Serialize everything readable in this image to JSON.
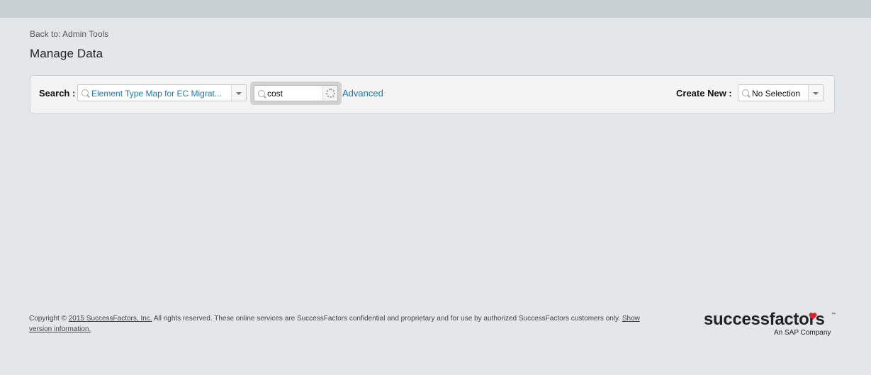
{
  "nav": {
    "back_link": "Back to: Admin Tools"
  },
  "page": {
    "title": "Manage Data"
  },
  "search": {
    "label": "Search :",
    "object_type_value": "Element Type Map for EC Migrat...",
    "query_value": "cost",
    "advanced_label": "Advanced"
  },
  "create": {
    "label": "Create New :",
    "value": "No Selection"
  },
  "footer": {
    "copyright_prefix": "Copyright ©",
    "company_link": "2015 SuccessFactors, Inc.",
    "rights_text": "All rights reserved. These online services are SuccessFactors confidential and proprietary and for use by authorized SuccessFactors customers only.",
    "version_link": "Show version information."
  },
  "logo": {
    "name": "successfactors",
    "trademark": "™",
    "tagline": "An SAP Company"
  },
  "icons": {
    "search": "magnifier-icon",
    "dropdown": "chevron-down-icon",
    "loading": "loading-spinner-icon",
    "heart": "heart-icon"
  },
  "colors": {
    "link": "#1a7bb8",
    "background": "#e4e7ea",
    "topbar": "#c8d0d4",
    "panel": "#f4f4f4",
    "heart": "#d8232a"
  }
}
